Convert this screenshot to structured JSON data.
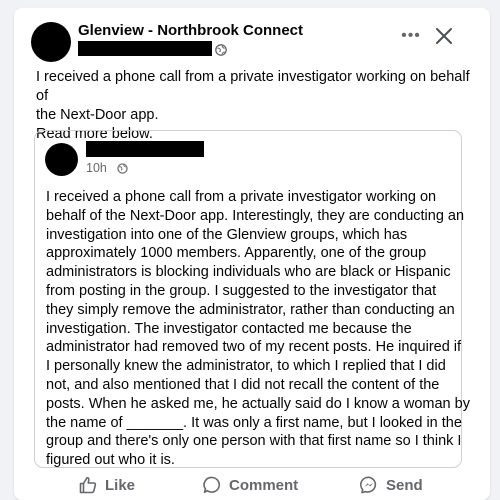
{
  "post": {
    "group_name": "Glenview - Northbrook Connect",
    "more_label": "•••",
    "text_lines": [
      "I received a phone call from a private investigator working on behalf of",
      "the Next-Door app.",
      "Read more below."
    ]
  },
  "shared_post": {
    "time": "10h",
    "text_lines": [
      "I received a phone call from a private investigator working on",
      "behalf of the Next-Door app. Interestingly, they are conducting an",
      "investigation into one of the Glenview groups, which has",
      "approximately 1000 members. Apparently, one of the group",
      "administrators is blocking individuals who are black or Hispanic",
      "from posting in the group. I suggested to the investigator that",
      "they simply remove the administrator, rather than conducting an",
      "investigation. The investigator contacted me because the",
      "administrator had removed two of my recent posts. He inquired if",
      "I personally knew the administrator, to which I replied that I did",
      "not, and also mentioned that I did not recall the content of the",
      "posts. When he asked me, he actually said do I know a woman by",
      "the name of _______. It was only a first name, but I looked in the",
      "group and there's only one person with that first name so I think I",
      "figured out who it is."
    ]
  },
  "actions": {
    "like": "Like",
    "comment": "Comment",
    "send": "Send"
  },
  "colors": {
    "background": "#f0f2f5",
    "text": "#050505",
    "secondary_text": "#65676b",
    "border": "#ced0d4"
  }
}
